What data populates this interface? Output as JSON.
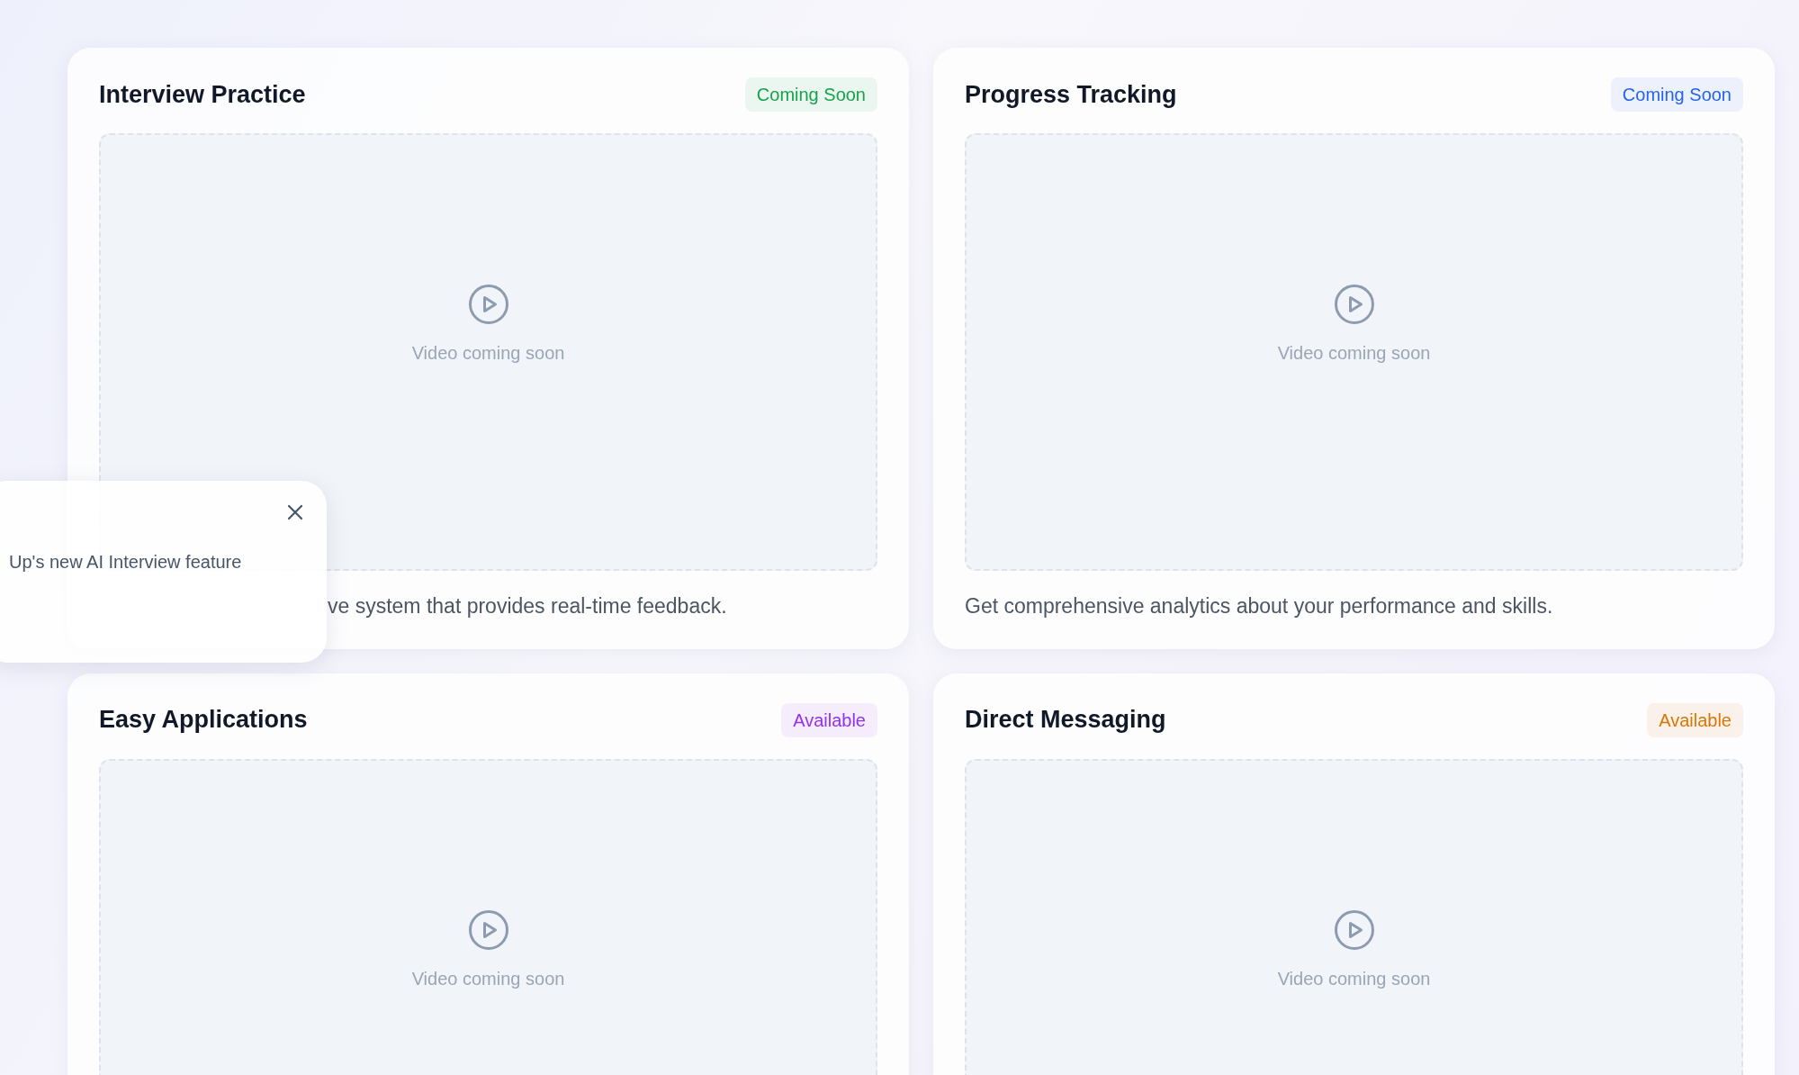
{
  "cards": [
    {
      "title": "Interview Practice",
      "badge": {
        "label": "Coming Soon",
        "color": "#16a34a"
      },
      "video_caption": "Video coming soon",
      "description": "ve system that provides real-time feedback."
    },
    {
      "title": "Progress Tracking",
      "badge": {
        "label": "Coming Soon",
        "color": "#2563eb"
      },
      "video_caption": "Video coming soon",
      "description": "Get comprehensive analytics about your performance and skills."
    },
    {
      "title": "Easy Applications",
      "badge": {
        "label": "Available",
        "color": "#9333ea"
      },
      "video_caption": "Video coming soon"
    },
    {
      "title": "Direct Messaging",
      "badge": {
        "label": "Available",
        "color": "#d97706"
      },
      "video_caption": "Video coming soon"
    }
  ],
  "toast": {
    "message": "Up's new AI Interview feature"
  }
}
